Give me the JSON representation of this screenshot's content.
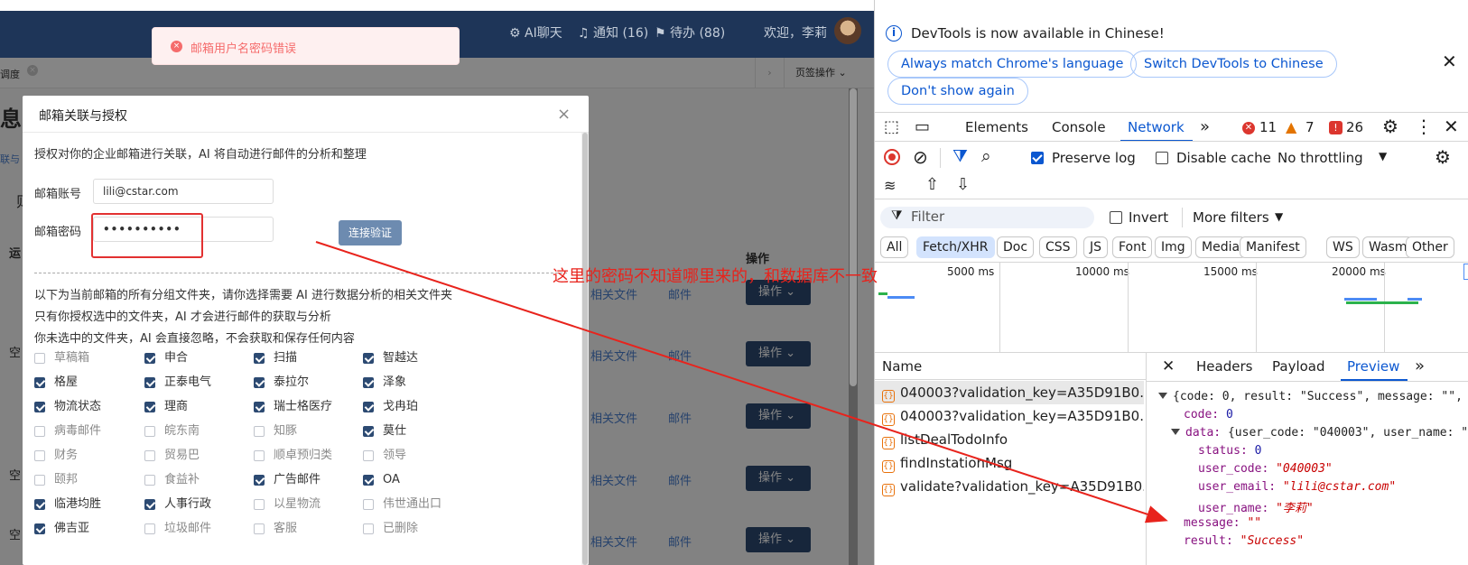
{
  "app": {
    "topbar": {
      "ai_chat": "AI聊天",
      "notify": "通知 (16)",
      "todo": "待办 (88)",
      "welcome": "欢迎，李莉"
    },
    "tab_label": "调度",
    "page_ops": "页签操作",
    "left_heading": "息",
    "left_link": "联与",
    "left_label": "则",
    "col_op": "操作",
    "col_left": "运",
    "row_prefix": "空",
    "row_link1": "相关文件",
    "row_link2": "邮件",
    "row_btn": "操作"
  },
  "toast": {
    "message": "邮箱用户名密码错误"
  },
  "dialog": {
    "title": "邮箱关联与授权",
    "intro": "授权对你的企业邮箱进行关联，AI 将自动进行邮件的分析和整理",
    "account_label": "邮箱账号",
    "account_value": "lili@cstar.com",
    "password_label": "邮箱密码",
    "password_value": "••••••••••",
    "verify_button": "连接验证",
    "desc1": "以下为当前邮箱的所有分组文件夹，请你选择需要 AI 进行数据分析的相关文件夹",
    "desc2": "只有你授权选中的文件夹，AI 才会进行邮件的获取与分析",
    "desc3": "你未选中的文件夹，AI 会直接忽略，不会获取和保存任何内容",
    "folders": [
      {
        "label": "草稿箱",
        "checked": false
      },
      {
        "label": "申合",
        "checked": true
      },
      {
        "label": "扫描",
        "checked": true
      },
      {
        "label": "智越达",
        "checked": true
      },
      {
        "label": "格屋",
        "checked": true
      },
      {
        "label": "正泰电气",
        "checked": true
      },
      {
        "label": "泰拉尔",
        "checked": true
      },
      {
        "label": "泽象",
        "checked": true
      },
      {
        "label": "物流状态",
        "checked": true
      },
      {
        "label": "理商",
        "checked": true
      },
      {
        "label": "瑞士格医疗",
        "checked": true
      },
      {
        "label": "戈冉珀",
        "checked": true
      },
      {
        "label": "病毒邮件",
        "checked": false
      },
      {
        "label": "皖东南",
        "checked": false
      },
      {
        "label": "知豚",
        "checked": false
      },
      {
        "label": "莫仕",
        "checked": true
      },
      {
        "label": "财务",
        "checked": false
      },
      {
        "label": "贸易巴",
        "checked": false
      },
      {
        "label": "顺卓预归类",
        "checked": false
      },
      {
        "label": "领导",
        "checked": false
      },
      {
        "label": "颐邦",
        "checked": false
      },
      {
        "label": "食益补",
        "checked": false
      },
      {
        "label": "广告邮件",
        "checked": true
      },
      {
        "label": "OA",
        "checked": true
      },
      {
        "label": "临港均胜",
        "checked": true
      },
      {
        "label": "人事行政",
        "checked": true
      },
      {
        "label": "以星物流",
        "checked": false
      },
      {
        "label": "伟世通出口",
        "checked": false
      },
      {
        "label": "佛吉亚",
        "checked": true
      },
      {
        "label": "垃圾邮件",
        "checked": false
      },
      {
        "label": "客服",
        "checked": false
      },
      {
        "label": "已删除",
        "checked": false
      }
    ]
  },
  "annotation": "这里的密码不知道哪里来的，和数据库不一致",
  "devtools": {
    "banner_text": "DevTools is now available in Chinese!",
    "btn_match": "Always match Chrome's language",
    "btn_switch": "Switch DevTools to Chinese",
    "btn_dont": "Don't show again",
    "tabs": [
      "Elements",
      "Console",
      "Network"
    ],
    "active_tab": "Network",
    "errors": "11",
    "warnings": "7",
    "issues": "26",
    "preserve_log": "Preserve log",
    "disable_cache": "Disable cache",
    "throttling": "No throttling",
    "filter_placeholder": "Filter",
    "invert": "Invert",
    "more_filters": "More filters",
    "chips": [
      "All",
      "Fetch/XHR",
      "Doc",
      "CSS",
      "JS",
      "Font",
      "Img",
      "Media",
      "Manifest",
      "WS",
      "Wasm",
      "Other"
    ],
    "timeline": [
      "5000 ms",
      "10000 ms",
      "15000 ms",
      "20000 ms"
    ],
    "name_header": "Name",
    "requests": [
      "040003?validation_key=A35D91B0...",
      "040003?validation_key=A35D91B0...",
      "listDealTodoInfo",
      "findInstationMsg",
      "validate?validation_key=A35D91B0..."
    ],
    "detail_tabs": [
      "Headers",
      "Payload",
      "Preview"
    ],
    "preview": {
      "summary": "{code: 0, result: \"Success\", message: \"\",",
      "code_key": "code:",
      "code_val": "0",
      "data_summary_key": "data:",
      "data_summary_val": "{user_code: \"040003\", user_name: \"",
      "status_key": "status:",
      "status_val": "0",
      "user_code_key": "user_code:",
      "user_code_val": "\"040003\"",
      "user_email_key": "user_email:",
      "user_email_val": "\"lili@cstar.com\"",
      "user_name_key": "user_name:",
      "user_name_val": "\"李莉\"",
      "message_key": "message:",
      "message_val": "\"\"",
      "result_key": "result:",
      "result_val": "\"Success\""
    }
  },
  "colors": {
    "topbar": "#1e3558",
    "accent": "#0b57d0",
    "annotation": "#e8231c",
    "toast_error": "#f56c6c"
  }
}
